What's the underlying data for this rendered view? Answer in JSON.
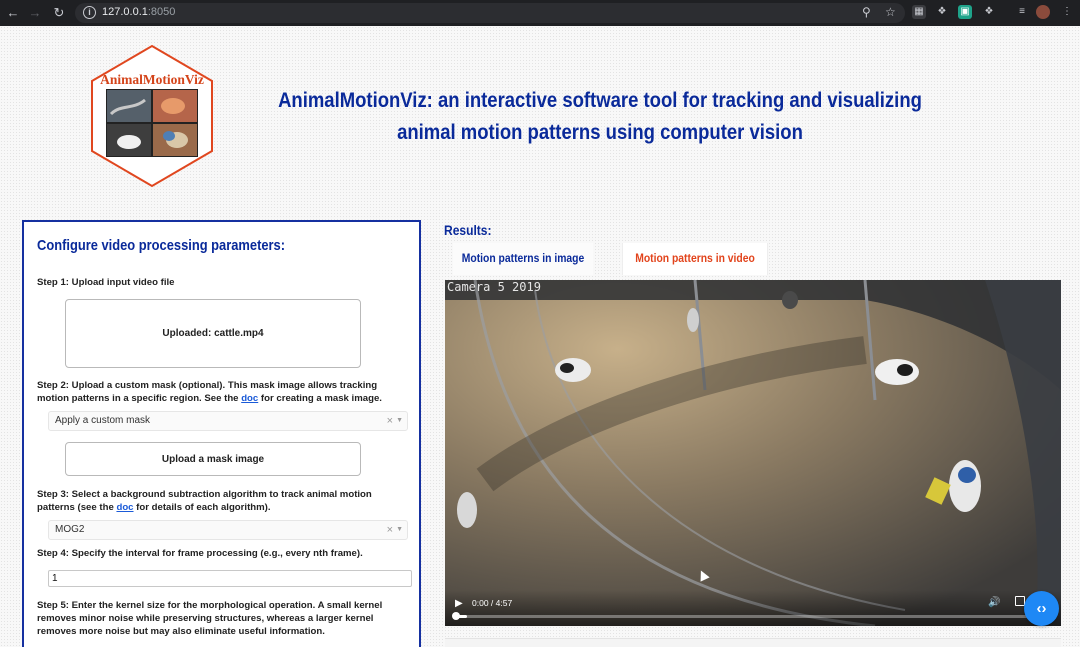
{
  "browser": {
    "url_host": "127.0.0.1",
    "url_port": ":8050"
  },
  "logo": {
    "text": "AnimalMotionViz",
    "border_color": "#e0471f",
    "text_color": "#d4441a"
  },
  "header": {
    "title": "AnimalMotionViz: an interactive software tool for tracking and visualizing animal motion patterns using computer vision"
  },
  "config": {
    "title": "Configure video processing parameters:",
    "step1": {
      "label": "Step 1: Upload input video file",
      "upload_text": "Uploaded: cattle.mp4"
    },
    "step2": {
      "label_before": "Step 2: Upload a custom mask (optional). This mask image allows tracking motion patterns in a specific region. See the ",
      "link": "doc",
      "label_after": " for creating a mask image.",
      "select_value": "Apply a custom mask",
      "upload_text": "Upload a mask image"
    },
    "step3": {
      "label_before": "Step 3: Select a background subtraction algorithm to track animal motion patterns (see the ",
      "link": "doc",
      "label_after": " for details of each algorithm).",
      "select_value": "MOG2"
    },
    "step4": {
      "label": "Step 4: Specify the interval for frame processing (e.g., every nth frame).",
      "value": "1"
    },
    "step5": {
      "label": "Step 5: Enter the kernel size for the morphological operation. A small kernel removes minor noise while preserving structures, whereas a larger kernel removes more noise but may also eliminate useful information."
    }
  },
  "results": {
    "label": "Results:",
    "tabs": [
      {
        "label": "Motion patterns in image",
        "active": false
      },
      {
        "label": "Motion patterns in video",
        "active": true
      }
    ],
    "video": {
      "overlay_text": "Camera 5 2019",
      "time": "0:00 / 4:57",
      "progress": 0.02
    }
  },
  "colors": {
    "title_blue": "#0a2a9a",
    "active_tab": "#e2441c",
    "link": "#1a5ad8",
    "fab": "#1e88f5"
  },
  "icons": {
    "fab": "code-brackets-icon",
    "play": "play-icon",
    "volume": "volume-icon",
    "fullscreen": "fullscreen-icon",
    "menu": "more-vert-icon"
  }
}
